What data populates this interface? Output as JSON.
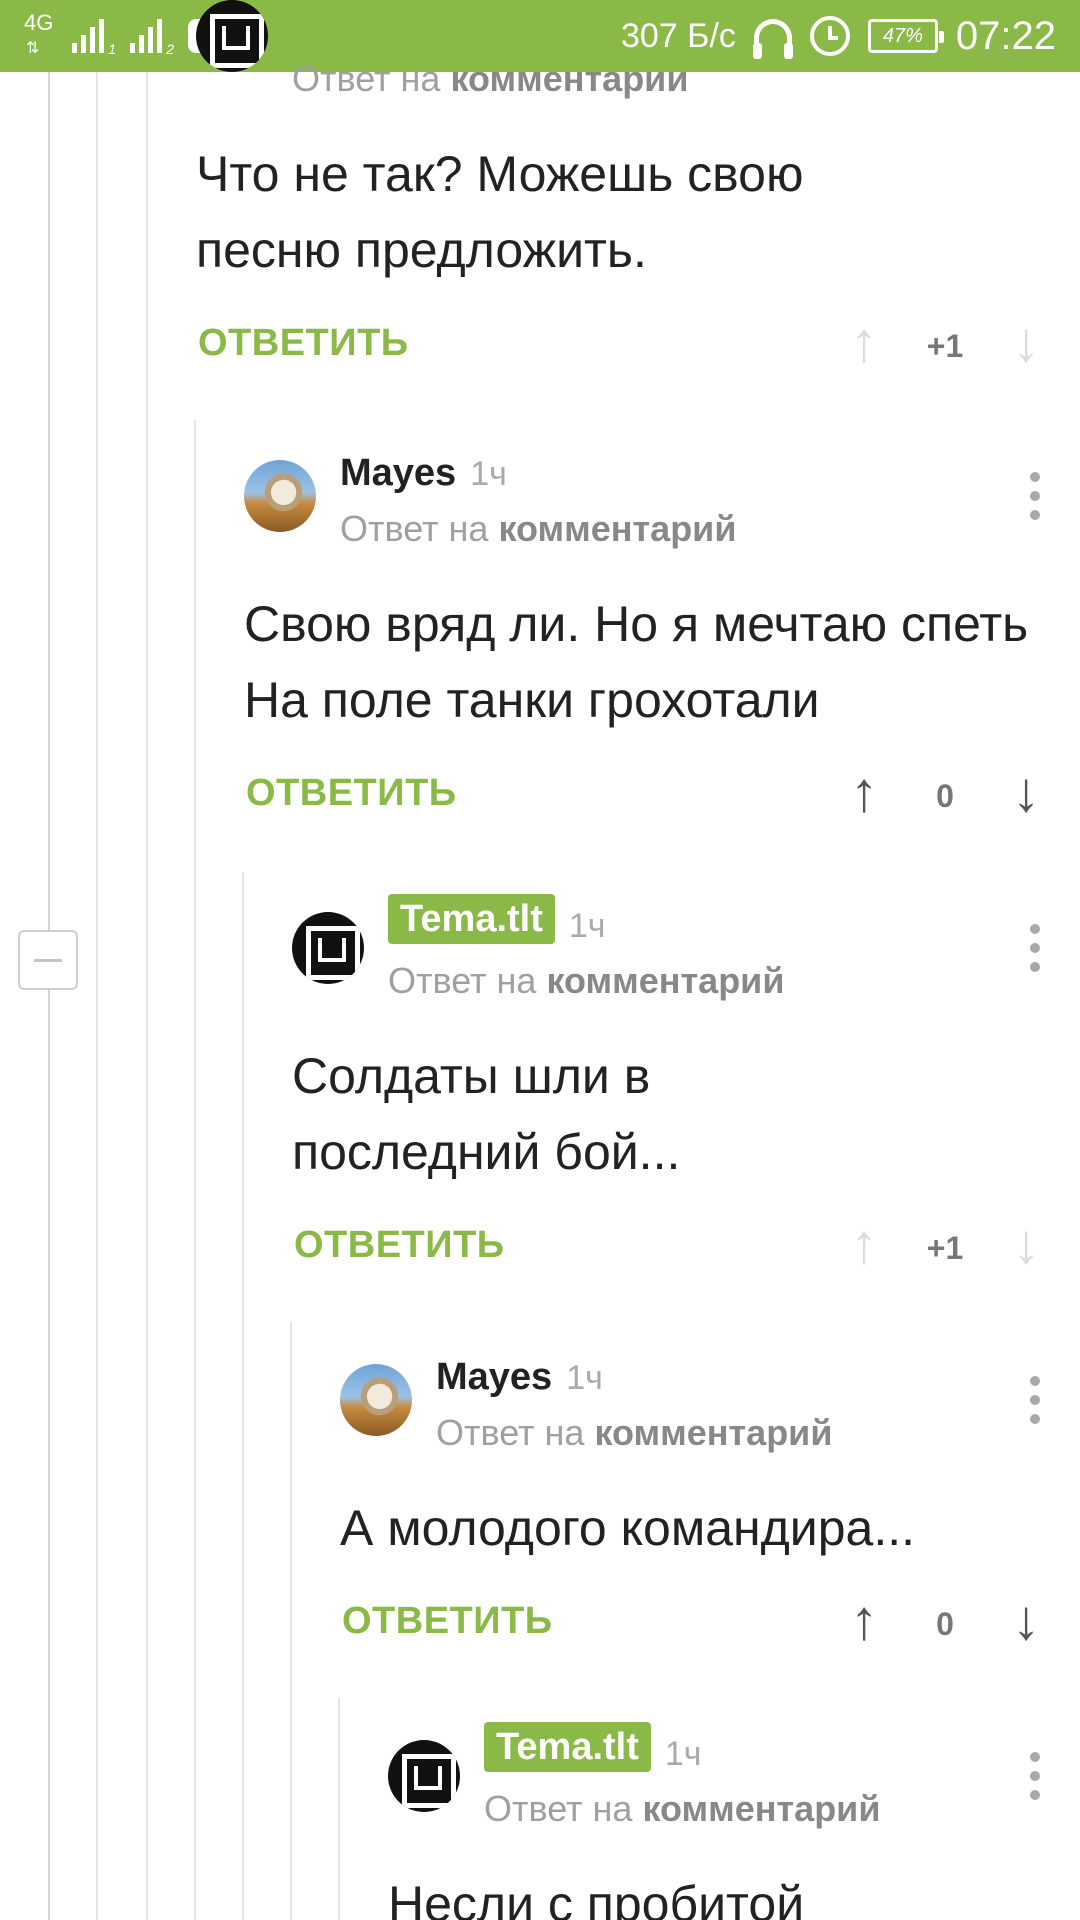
{
  "status_bar": {
    "network": "4G",
    "sim1": "1",
    "sim2": "2",
    "speed": "307 Б/с",
    "battery": "47%",
    "time": "07:22"
  },
  "top_fragment": {
    "reply_prefix": "Ответ на",
    "reply_target": "комментарии",
    "text": "Что не так? Можешь свою песню предложить.",
    "reply_label": "ОТВЕТИТЬ",
    "score": "+1"
  },
  "comments": [
    {
      "author": "Mayes",
      "time": "1ч",
      "reply_prefix": "Ответ на",
      "reply_target": "комментарий",
      "text": "Свою вряд ли. Но я мечтаю спеть На поле танки грохотали",
      "reply_label": "ОТВЕТИТЬ",
      "score": "0"
    },
    {
      "author": "Tema.tlt",
      "time": "1ч",
      "reply_prefix": "Ответ на",
      "reply_target": "комментарий",
      "text": "Солдаты шли в последний бой...",
      "reply_label": "ОТВЕТИТЬ",
      "score": "+1"
    },
    {
      "author": "Mayes",
      "time": "1ч",
      "reply_prefix": "Ответ на",
      "reply_target": "комментарий",
      "text": "А молодого командира...",
      "reply_label": "ОТВЕТИТЬ",
      "score": "0"
    },
    {
      "author": "Tema.tlt",
      "time": "1ч",
      "reply_prefix": "Ответ на",
      "reply_target": "комментарий",
      "text": "Несли с пробитой"
    }
  ],
  "icons": {
    "upvote": "arrow-up-icon",
    "downvote": "arrow-down-icon",
    "menu": "kebab-menu-icon",
    "collapse": "collapse-minus-icon"
  },
  "colors": {
    "accent": "#8ab947",
    "text": "#222222",
    "muted": "#a0a0a0"
  }
}
